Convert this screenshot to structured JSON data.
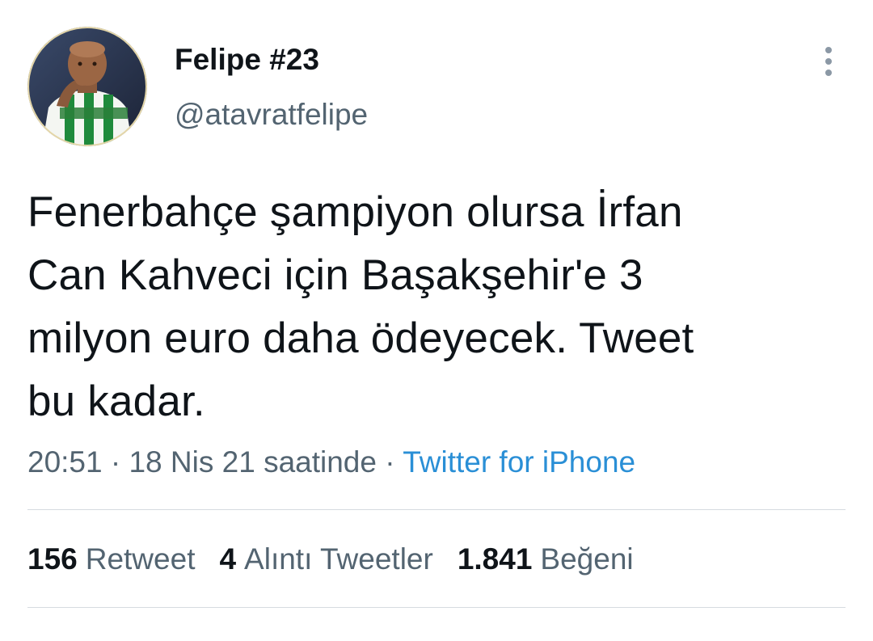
{
  "author": {
    "display_name": "Felipe #23",
    "handle": "@atavratfelipe",
    "avatar_icon": "profile-photo-icon"
  },
  "tweet": {
    "lines": [
      "Fenerbahçe şampiyon olursa İrfan",
      "Can Kahveci için Başakşehir'e 3",
      "milyon euro daha ödeyecek. Tweet",
      "bu kadar."
    ]
  },
  "meta": {
    "time": "20:51",
    "separator": " · ",
    "date": "18 Nis 21 saatinde",
    "source": "Twitter for iPhone"
  },
  "stats": {
    "retweets_count": "156",
    "retweets_label": "Retweet",
    "quotes_count": "4",
    "quotes_label": "Alıntı Tweetler",
    "likes_count": "1.841",
    "likes_label": "Beğeni"
  },
  "icons": {
    "more": "more-vertical-icon"
  },
  "colors": {
    "text_primary": "#0f1419",
    "text_secondary": "#536471",
    "link": "#2a8fd6",
    "divider": "#d6dbe0"
  }
}
